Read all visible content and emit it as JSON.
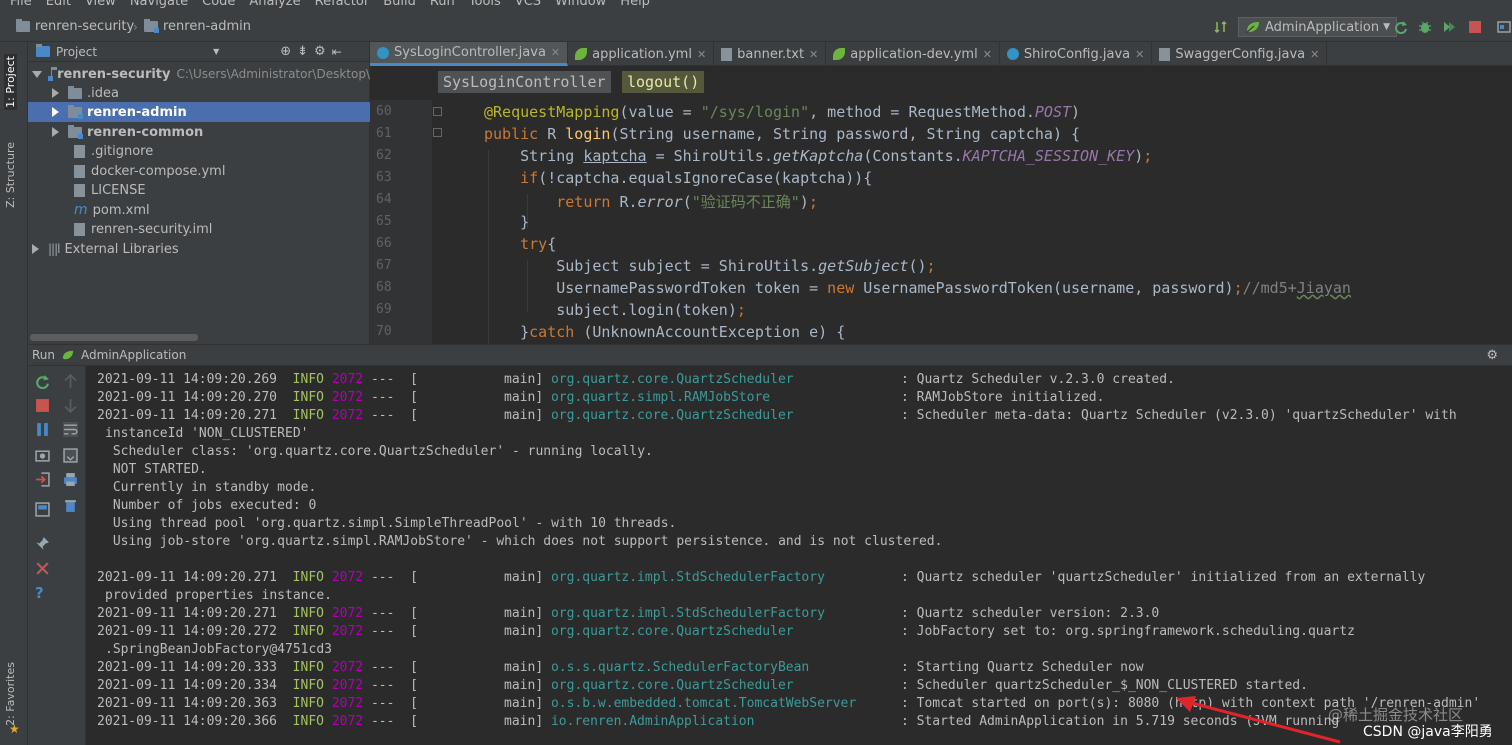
{
  "menu": [
    "File",
    "Edit",
    "View",
    "Navigate",
    "Code",
    "Analyze",
    "Refactor",
    "Build",
    "Run",
    "Tools",
    "VCS",
    "Window",
    "Help"
  ],
  "nav": {
    "project": "renren-security",
    "module": "renren-admin",
    "run_config": "AdminApplication"
  },
  "left_stripe": {
    "project_tab": "1: Project",
    "structure_tab": "Z: Structure",
    "favorites_tab": "2: Favorites"
  },
  "project_panel": {
    "title": "Project",
    "tree": [
      {
        "label": "renren-security",
        "hint": "C:\\Users\\Administrator\\Desktop\\",
        "kind": "root"
      },
      {
        "label": ".idea",
        "kind": "folder"
      },
      {
        "label": "renren-admin",
        "kind": "module",
        "selected": true
      },
      {
        "label": "renren-common",
        "kind": "module"
      },
      {
        "label": ".gitignore",
        "kind": "file"
      },
      {
        "label": "docker-compose.yml",
        "kind": "file"
      },
      {
        "label": "LICENSE",
        "kind": "file"
      },
      {
        "label": "pom.xml",
        "kind": "file"
      },
      {
        "label": "renren-security.iml",
        "kind": "file"
      },
      {
        "label": "External Libraries",
        "kind": "lib"
      }
    ]
  },
  "tabs": [
    {
      "label": "SysLoginController.java",
      "icon": "class-icon",
      "active": true
    },
    {
      "label": "application.yml",
      "icon": "spring-icon"
    },
    {
      "label": "banner.txt",
      "icon": "text-file-icon"
    },
    {
      "label": "application-dev.yml",
      "icon": "spring-icon"
    },
    {
      "label": "ShiroConfig.java",
      "icon": "class-icon"
    },
    {
      "label": "SwaggerConfig.java",
      "icon": "config-icon"
    }
  ],
  "editor": {
    "crumb_class": "SysLoginController",
    "crumb_method": "logout()",
    "line_numbers": [
      "60",
      "61",
      "62",
      "63",
      "64",
      "65",
      "66",
      "67",
      "68",
      "69",
      "70"
    ]
  },
  "run_panel": {
    "label": "Run",
    "config": "AdminApplication"
  },
  "console": [
    {
      "ts": "2021-09-11 14:09:20.269",
      "level": "INFO",
      "pid": "2072",
      "thread": "---  [           main]",
      "logger": "org.quartz.core.QuartzScheduler",
      "msg": ": Quartz Scheduler v.2.3.0 created."
    },
    {
      "ts": "2021-09-11 14:09:20.270",
      "level": "INFO",
      "pid": "2072",
      "thread": "---  [           main]",
      "logger": "org.quartz.simpl.RAMJobStore",
      "msg": ": RAMJobStore initialized."
    },
    {
      "ts": "2021-09-11 14:09:20.271",
      "level": "INFO",
      "pid": "2072",
      "thread": "---  [           main]",
      "logger": "org.quartz.core.QuartzScheduler",
      "msg": ": Scheduler meta-data: Quartz Scheduler (v2.3.0) 'quartzScheduler' with"
    },
    {
      "text": "instanceId 'NON_CLUSTERED'"
    },
    {
      "text": " Scheduler class: 'org.quartz.core.QuartzScheduler' - running locally."
    },
    {
      "text": " NOT STARTED."
    },
    {
      "text": " Currently in standby mode."
    },
    {
      "text": " Number of jobs executed: 0"
    },
    {
      "text": " Using thread pool 'org.quartz.simpl.SimpleThreadPool' - with 10 threads."
    },
    {
      "text": " Using job-store 'org.quartz.simpl.RAMJobStore' - which does not support persistence. and is not clustered."
    },
    {
      "text": ""
    },
    {
      "ts": "2021-09-11 14:09:20.271",
      "level": "INFO",
      "pid": "2072",
      "thread": "---  [           main]",
      "logger": "org.quartz.impl.StdSchedulerFactory",
      "msg": ": Quartz scheduler 'quartzScheduler' initialized from an externally"
    },
    {
      "text": "provided properties instance."
    },
    {
      "ts": "2021-09-11 14:09:20.271",
      "level": "INFO",
      "pid": "2072",
      "thread": "---  [           main]",
      "logger": "org.quartz.impl.StdSchedulerFactory",
      "msg": ": Quartz scheduler version: 2.3.0"
    },
    {
      "ts": "2021-09-11 14:09:20.272",
      "level": "INFO",
      "pid": "2072",
      "thread": "---  [           main]",
      "logger": "org.quartz.core.QuartzScheduler",
      "msg": ": JobFactory set to: org.springframework.scheduling.quartz"
    },
    {
      "text": ".SpringBeanJobFactory@4751cd3"
    },
    {
      "ts": "2021-09-11 14:09:20.333",
      "level": "INFO",
      "pid": "2072",
      "thread": "---  [           main]",
      "logger": "o.s.s.quartz.SchedulerFactoryBean",
      "msg": ": Starting Quartz Scheduler now"
    },
    {
      "ts": "2021-09-11 14:09:20.334",
      "level": "INFO",
      "pid": "2072",
      "thread": "---  [           main]",
      "logger": "org.quartz.core.QuartzScheduler",
      "msg": ": Scheduler quartzScheduler_$_NON_CLUSTERED started."
    },
    {
      "ts": "2021-09-11 14:09:20.363",
      "level": "INFO",
      "pid": "2072",
      "thread": "---  [           main]",
      "logger": "o.s.b.w.embedded.tomcat.TomcatWebServer",
      "msg": ": Tomcat started on port(s): 8080 (http) with context path '/renren-admin'"
    },
    {
      "ts": "2021-09-11 14:09:20.366",
      "level": "INFO",
      "pid": "2072",
      "thread": "---  [           main]",
      "logger": "io.renren.AdminApplication",
      "msg": ": Started AdminApplication in 5.719 seconds (JVM running"
    }
  ],
  "watermark": {
    "juejin": "@稀土掘金技术社区",
    "csdn": "CSDN @java李阳勇"
  },
  "colors": {
    "accent": "#4a88c7",
    "selection": "#4b6eaf",
    "info": "#a5c261",
    "pid": "#b200b2",
    "logger": "#3d9a9a",
    "arrow": "#e0242a"
  }
}
